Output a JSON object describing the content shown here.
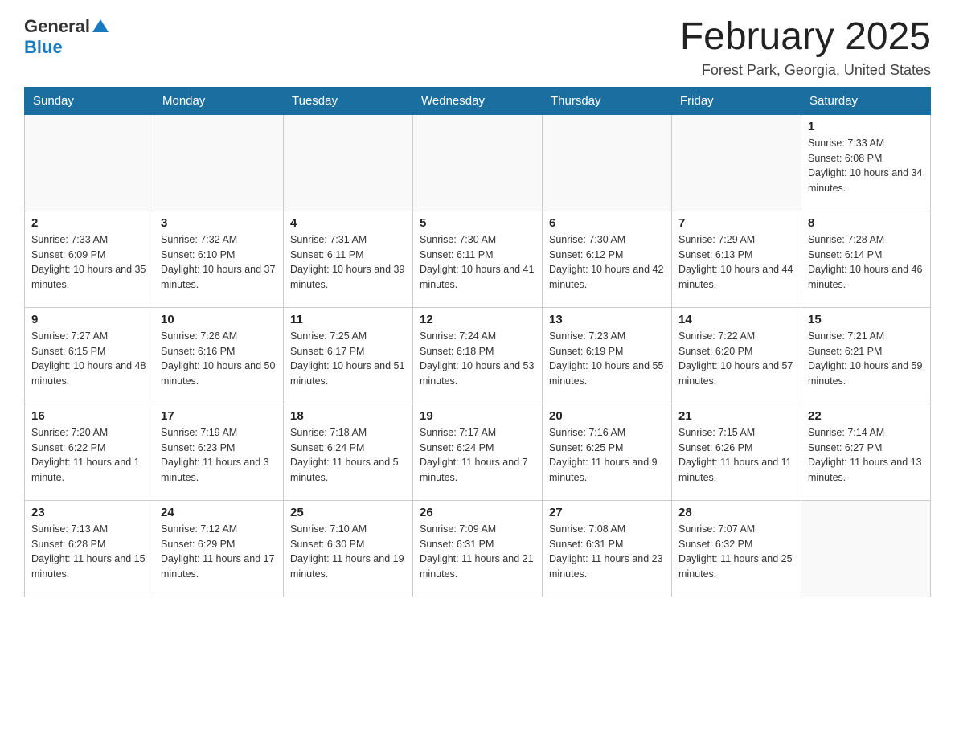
{
  "header": {
    "logo_general": "General",
    "logo_blue": "Blue",
    "month_title": "February 2025",
    "location": "Forest Park, Georgia, United States"
  },
  "weekdays": [
    "Sunday",
    "Monday",
    "Tuesday",
    "Wednesday",
    "Thursday",
    "Friday",
    "Saturday"
  ],
  "weeks": [
    [
      {
        "day": "",
        "sunrise": "",
        "sunset": "",
        "daylight": ""
      },
      {
        "day": "",
        "sunrise": "",
        "sunset": "",
        "daylight": ""
      },
      {
        "day": "",
        "sunrise": "",
        "sunset": "",
        "daylight": ""
      },
      {
        "day": "",
        "sunrise": "",
        "sunset": "",
        "daylight": ""
      },
      {
        "day": "",
        "sunrise": "",
        "sunset": "",
        "daylight": ""
      },
      {
        "day": "",
        "sunrise": "",
        "sunset": "",
        "daylight": ""
      },
      {
        "day": "1",
        "sunrise": "Sunrise: 7:33 AM",
        "sunset": "Sunset: 6:08 PM",
        "daylight": "Daylight: 10 hours and 34 minutes."
      }
    ],
    [
      {
        "day": "2",
        "sunrise": "Sunrise: 7:33 AM",
        "sunset": "Sunset: 6:09 PM",
        "daylight": "Daylight: 10 hours and 35 minutes."
      },
      {
        "day": "3",
        "sunrise": "Sunrise: 7:32 AM",
        "sunset": "Sunset: 6:10 PM",
        "daylight": "Daylight: 10 hours and 37 minutes."
      },
      {
        "day": "4",
        "sunrise": "Sunrise: 7:31 AM",
        "sunset": "Sunset: 6:11 PM",
        "daylight": "Daylight: 10 hours and 39 minutes."
      },
      {
        "day": "5",
        "sunrise": "Sunrise: 7:30 AM",
        "sunset": "Sunset: 6:11 PM",
        "daylight": "Daylight: 10 hours and 41 minutes."
      },
      {
        "day": "6",
        "sunrise": "Sunrise: 7:30 AM",
        "sunset": "Sunset: 6:12 PM",
        "daylight": "Daylight: 10 hours and 42 minutes."
      },
      {
        "day": "7",
        "sunrise": "Sunrise: 7:29 AM",
        "sunset": "Sunset: 6:13 PM",
        "daylight": "Daylight: 10 hours and 44 minutes."
      },
      {
        "day": "8",
        "sunrise": "Sunrise: 7:28 AM",
        "sunset": "Sunset: 6:14 PM",
        "daylight": "Daylight: 10 hours and 46 minutes."
      }
    ],
    [
      {
        "day": "9",
        "sunrise": "Sunrise: 7:27 AM",
        "sunset": "Sunset: 6:15 PM",
        "daylight": "Daylight: 10 hours and 48 minutes."
      },
      {
        "day": "10",
        "sunrise": "Sunrise: 7:26 AM",
        "sunset": "Sunset: 6:16 PM",
        "daylight": "Daylight: 10 hours and 50 minutes."
      },
      {
        "day": "11",
        "sunrise": "Sunrise: 7:25 AM",
        "sunset": "Sunset: 6:17 PM",
        "daylight": "Daylight: 10 hours and 51 minutes."
      },
      {
        "day": "12",
        "sunrise": "Sunrise: 7:24 AM",
        "sunset": "Sunset: 6:18 PM",
        "daylight": "Daylight: 10 hours and 53 minutes."
      },
      {
        "day": "13",
        "sunrise": "Sunrise: 7:23 AM",
        "sunset": "Sunset: 6:19 PM",
        "daylight": "Daylight: 10 hours and 55 minutes."
      },
      {
        "day": "14",
        "sunrise": "Sunrise: 7:22 AM",
        "sunset": "Sunset: 6:20 PM",
        "daylight": "Daylight: 10 hours and 57 minutes."
      },
      {
        "day": "15",
        "sunrise": "Sunrise: 7:21 AM",
        "sunset": "Sunset: 6:21 PM",
        "daylight": "Daylight: 10 hours and 59 minutes."
      }
    ],
    [
      {
        "day": "16",
        "sunrise": "Sunrise: 7:20 AM",
        "sunset": "Sunset: 6:22 PM",
        "daylight": "Daylight: 11 hours and 1 minute."
      },
      {
        "day": "17",
        "sunrise": "Sunrise: 7:19 AM",
        "sunset": "Sunset: 6:23 PM",
        "daylight": "Daylight: 11 hours and 3 minutes."
      },
      {
        "day": "18",
        "sunrise": "Sunrise: 7:18 AM",
        "sunset": "Sunset: 6:24 PM",
        "daylight": "Daylight: 11 hours and 5 minutes."
      },
      {
        "day": "19",
        "sunrise": "Sunrise: 7:17 AM",
        "sunset": "Sunset: 6:24 PM",
        "daylight": "Daylight: 11 hours and 7 minutes."
      },
      {
        "day": "20",
        "sunrise": "Sunrise: 7:16 AM",
        "sunset": "Sunset: 6:25 PM",
        "daylight": "Daylight: 11 hours and 9 minutes."
      },
      {
        "day": "21",
        "sunrise": "Sunrise: 7:15 AM",
        "sunset": "Sunset: 6:26 PM",
        "daylight": "Daylight: 11 hours and 11 minutes."
      },
      {
        "day": "22",
        "sunrise": "Sunrise: 7:14 AM",
        "sunset": "Sunset: 6:27 PM",
        "daylight": "Daylight: 11 hours and 13 minutes."
      }
    ],
    [
      {
        "day": "23",
        "sunrise": "Sunrise: 7:13 AM",
        "sunset": "Sunset: 6:28 PM",
        "daylight": "Daylight: 11 hours and 15 minutes."
      },
      {
        "day": "24",
        "sunrise": "Sunrise: 7:12 AM",
        "sunset": "Sunset: 6:29 PM",
        "daylight": "Daylight: 11 hours and 17 minutes."
      },
      {
        "day": "25",
        "sunrise": "Sunrise: 7:10 AM",
        "sunset": "Sunset: 6:30 PM",
        "daylight": "Daylight: 11 hours and 19 minutes."
      },
      {
        "day": "26",
        "sunrise": "Sunrise: 7:09 AM",
        "sunset": "Sunset: 6:31 PM",
        "daylight": "Daylight: 11 hours and 21 minutes."
      },
      {
        "day": "27",
        "sunrise": "Sunrise: 7:08 AM",
        "sunset": "Sunset: 6:31 PM",
        "daylight": "Daylight: 11 hours and 23 minutes."
      },
      {
        "day": "28",
        "sunrise": "Sunrise: 7:07 AM",
        "sunset": "Sunset: 6:32 PM",
        "daylight": "Daylight: 11 hours and 25 minutes."
      },
      {
        "day": "",
        "sunrise": "",
        "sunset": "",
        "daylight": ""
      }
    ]
  ]
}
